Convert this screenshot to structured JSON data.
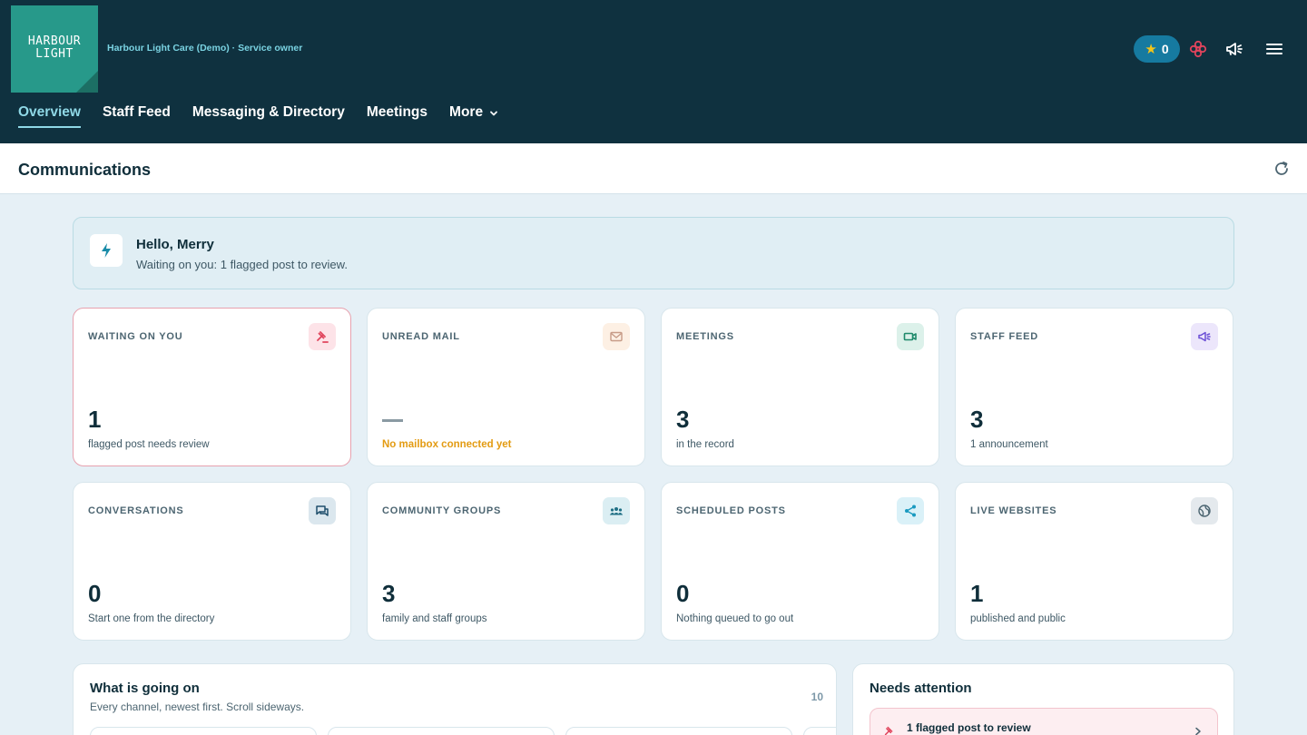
{
  "header": {
    "logo_line1": "HARBOUR",
    "logo_line2": "LIGHT",
    "org_label": "Harbour Light Care (Demo) · Service owner",
    "points": "0",
    "nav": [
      {
        "label": "Overview",
        "active": true
      },
      {
        "label": "Staff Feed"
      },
      {
        "label": "Messaging & Directory"
      },
      {
        "label": "Meetings"
      },
      {
        "label": "More"
      }
    ],
    "icons": [
      "star-icon",
      "flower-icon",
      "megaphone-icon",
      "menu-icon"
    ]
  },
  "page": {
    "title": "Communications"
  },
  "greeting": {
    "hello": "Hello, Merry",
    "sub": "Waiting on you: 1 flagged post to review."
  },
  "cards": [
    {
      "label": "WAITING ON YOU",
      "value": "1",
      "desc": "flagged post needs review",
      "icon": "gavel-icon",
      "accent": "#e0445c"
    },
    {
      "label": "UNREAD MAIL",
      "value": "",
      "desc": "No mailbox connected yet",
      "icon": "mail-icon",
      "accent": "#e39b12"
    },
    {
      "label": "MEETINGS",
      "value": "3",
      "desc": "in the record",
      "icon": "video-icon",
      "accent": "#1f8a6b"
    },
    {
      "label": "STAFF FEED",
      "value": "3",
      "desc": "1 announcement",
      "icon": "megaphone-icon",
      "accent": "#6b4fd6"
    },
    {
      "label": "CONVERSATIONS",
      "value": "0",
      "desc": "Start one from the directory",
      "icon": "chat-icon",
      "accent": "#1f4f6b"
    },
    {
      "label": "COMMUNITY GROUPS",
      "value": "3",
      "desc": "family and staff groups",
      "icon": "group-icon",
      "accent": "#1f6f85"
    },
    {
      "label": "SCHEDULED POSTS",
      "value": "0",
      "desc": "Nothing queued to go out",
      "icon": "share-icon",
      "accent": "#1a9ac0"
    },
    {
      "label": "LIVE WEBSITES",
      "value": "1",
      "desc": "published and public",
      "icon": "globe-icon",
      "accent": "#4c6571"
    }
  ],
  "activity": {
    "title": "What is going on",
    "sub": "Every channel, newest first. Scroll sideways.",
    "count": "10"
  },
  "attention": {
    "title": "Needs attention",
    "items": [
      {
        "label": "1 flagged post to review"
      }
    ]
  }
}
